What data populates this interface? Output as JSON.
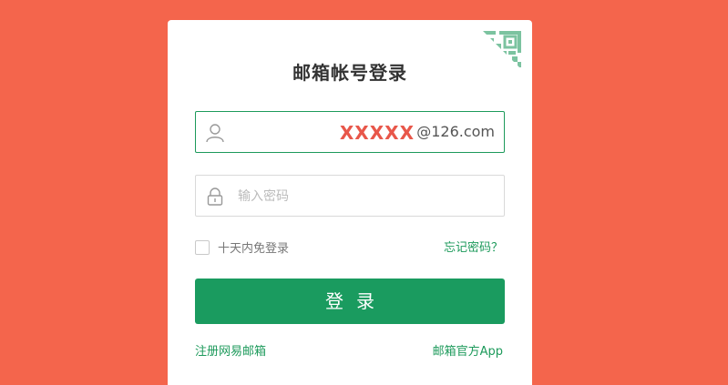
{
  "page": {
    "background_color": "#f4654c",
    "accent_color": "#1a9b5f"
  },
  "login": {
    "title": "邮箱帐号登录",
    "account": {
      "icon": "user-icon",
      "masked_value": "XXXXX",
      "domain_suffix": "@126.com"
    },
    "password": {
      "icon": "lock-icon",
      "placeholder": "输入密码"
    },
    "remember_label": "十天内免登录",
    "forgot_label": "忘记密码？",
    "submit_label": "登录",
    "register_label": "注册网易邮箱",
    "app_label": "邮箱官方App",
    "qr_icon": "qr-code-icon"
  }
}
